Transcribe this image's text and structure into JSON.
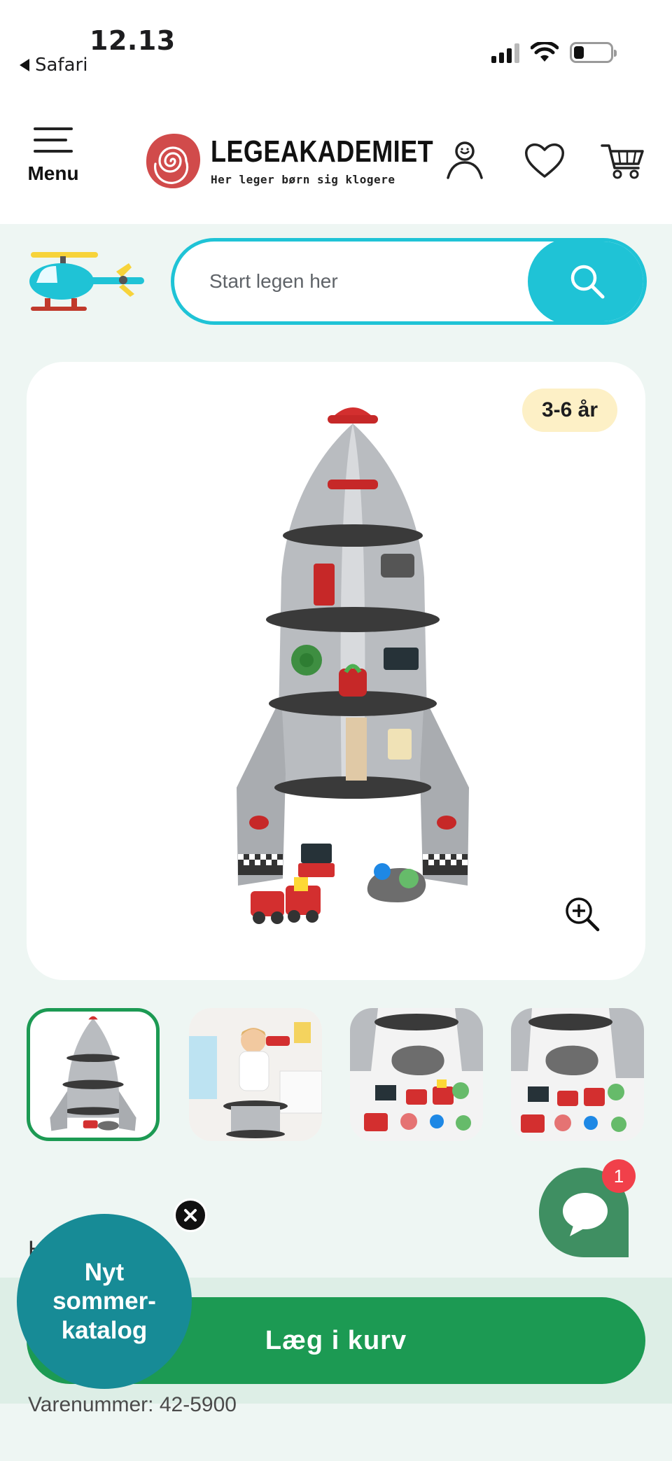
{
  "status_bar": {
    "time": "12.13",
    "back_app": "Safari"
  },
  "header": {
    "menu_label": "Menu",
    "logo_name": "LEGEAKADEMIET",
    "logo_tagline": "Her leger børn sig klogere",
    "icons": [
      "account-icon",
      "heart-icon",
      "cart-icon"
    ]
  },
  "search": {
    "placeholder": "Start legen her"
  },
  "product": {
    "age_badge": "3-6 år",
    "thumbnail_count": 4
  },
  "chat": {
    "badge_count": "1"
  },
  "cart": {
    "add_to_cart_label": "Læg i kurv"
  },
  "partially_visible": {
    "heading_fragment": "H",
    "item_number": "Varenummer: 42-5900"
  },
  "promo": {
    "text": "Nyt\nsommer-\nkatalog"
  },
  "colors": {
    "accent_cyan": "#1fc3d6",
    "cart_green": "#1c9a53",
    "promo_teal": "#178b96",
    "age_badge_bg": "#fdf0c6",
    "chat_badge_red": "#f1404a"
  }
}
